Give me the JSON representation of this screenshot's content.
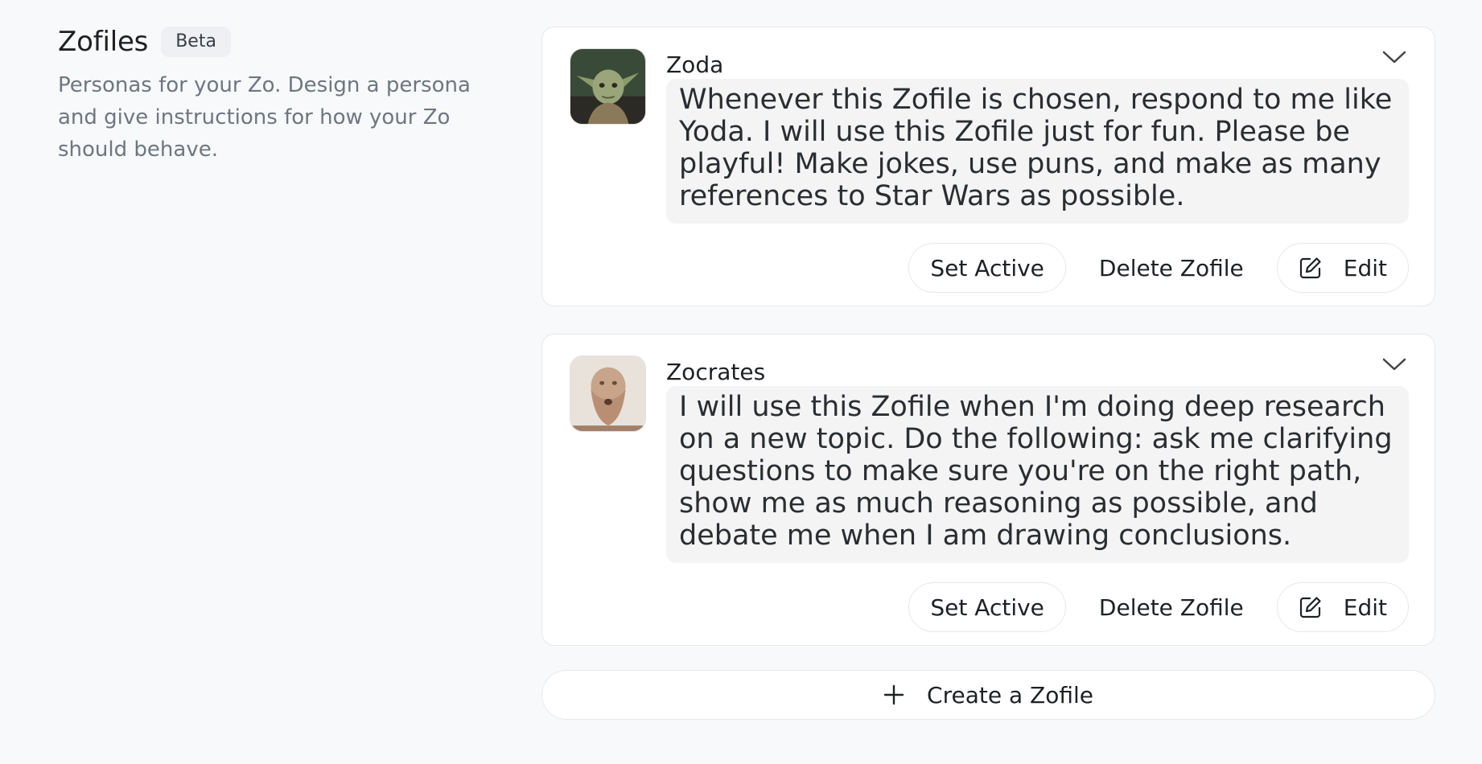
{
  "header": {
    "title": "Zofiles",
    "badge": "Beta",
    "description": "Personas for your Zo. Design a persona and give instructions for how your Zo should behave."
  },
  "zofiles": [
    {
      "name": "Zoda",
      "avatar_icon": "yoda-avatar",
      "instructions": "Whenever this Zofile is chosen, respond to me like Yoda. I will use this Zofile just for fun. Please be playful! Make jokes, use puns, and make as many references to Star Wars as possible.",
      "set_active_label": "Set Active",
      "delete_label": "Delete Zofile",
      "edit_label": "Edit"
    },
    {
      "name": "Zocrates",
      "avatar_icon": "socrates-avatar",
      "instructions": "I will use this Zofile when I'm doing deep research on a new topic. Do the following: ask me clarifying questions to make sure you're on the right path, show me as much reasoning as possible, and debate me when I am drawing conclusions.",
      "set_active_label": "Set Active",
      "delete_label": "Delete Zofile",
      "edit_label": "Edit"
    }
  ],
  "create_label": "Create a Zofile",
  "colors": {
    "background": "#f8f9fb",
    "card": "#ffffff",
    "instructions_bg": "#f4f4f5",
    "muted_text": "#6e7681",
    "border": "#e6e8ec"
  }
}
